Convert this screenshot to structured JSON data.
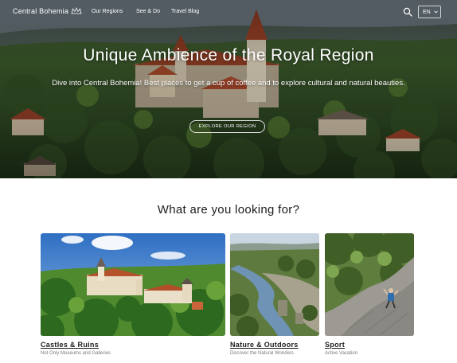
{
  "header": {
    "logo_text": "Central Bohemia",
    "nav": [
      "Our Regions",
      "See & Do",
      "Travel Blog"
    ],
    "language": "EN"
  },
  "hero": {
    "title": "Unique Ambience of the Royal Region",
    "subtitle": "Dive into Central Bohemia! Best places to get a cup of coffee and to explore cultural and natural beauties.",
    "cta_label": "EXPLORE OUR REGION"
  },
  "section": {
    "title": "What are you looking for?"
  },
  "cards": [
    {
      "title": "Castles & Ruins",
      "subtitle": "Not Only Museums and Galleries"
    },
    {
      "title": "Nature & Outdoors",
      "subtitle": "Discover the Natural Wonders"
    },
    {
      "title": "Sport",
      "subtitle": "Active Vacation"
    }
  ],
  "icons": {
    "search": "search-icon",
    "chevron": "chevron-down-icon",
    "logo_mark": "crown-icon"
  }
}
